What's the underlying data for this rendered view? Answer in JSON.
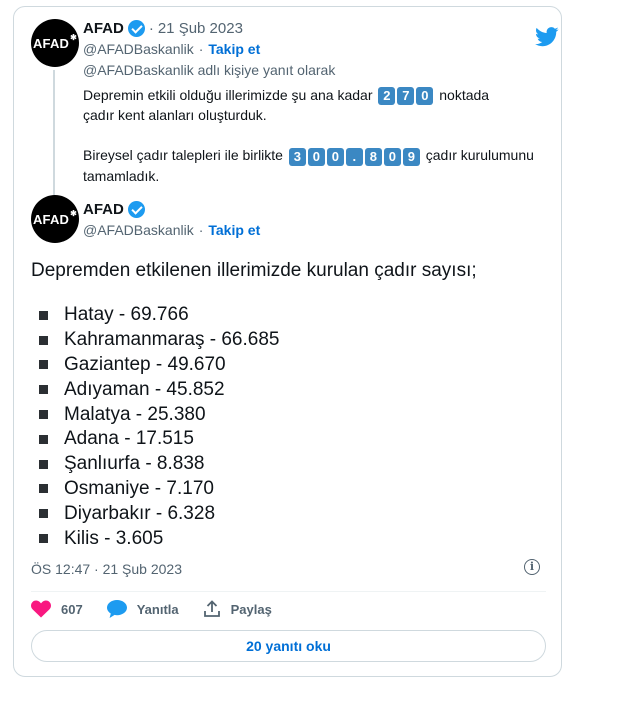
{
  "quoted_tweet": {
    "avatar_text": "AFAD",
    "author_name": "AFAD",
    "separator": "·",
    "date": "21 Şub 2023",
    "handle": "@AFADBaskanlik",
    "follow_label": "Takip et",
    "reply_context": "@AFADBaskanlik adlı kişiye yanıt olarak",
    "line1_before": "Depremin etkili olduğu illerimizde şu ana kadar",
    "line1_digits": [
      "2",
      "7",
      "0"
    ],
    "line1_after": "noktada",
    "line2": "çadır kent alanları oluşturduk.",
    "line3_before": "Bireysel çadır talepleri ile birlikte",
    "line3_digits": [
      "3",
      "0",
      "0",
      ".",
      "8",
      "0",
      "9"
    ],
    "line3_after": "çadır kurulumunu",
    "line4": "tamamladık."
  },
  "main_tweet": {
    "avatar_text": "AFAD",
    "author_name": "AFAD",
    "handle": "@AFADBaskanlik",
    "separator": "·",
    "follow_label": "Takip et",
    "intro": "Depremden etkilenen illerimizde kurulan çadır sayısı;",
    "items": [
      "Hatay - 69.766",
      "Kahramanmaraş - 66.685",
      "Gaziantep - 49.670",
      "Adıyaman - 45.852",
      "Malatya - 25.380",
      "Adana - 17.515",
      "Şanlıurfa - 8.838",
      "Osmaniye - 7.170",
      "Diyarbakır - 6.328",
      "Kilis - 3.605"
    ],
    "timestamp": "ÖS 12:47 · 21 Şub 2023",
    "info_glyph": "i",
    "like_count": "607",
    "reply_label": "Yanıtla",
    "share_label": "Paylaş",
    "read_replies_label": "20 yanıtı oku"
  },
  "colors": {
    "accent": "#1d9bf0",
    "link": "#006fd6",
    "heart": "#f91880",
    "digit_bg": "#3b88c3"
  },
  "icons": [
    "twitter-bird-icon",
    "verified-badge-icon",
    "info-icon",
    "heart-icon",
    "reply-bubble-icon",
    "share-icon"
  ]
}
